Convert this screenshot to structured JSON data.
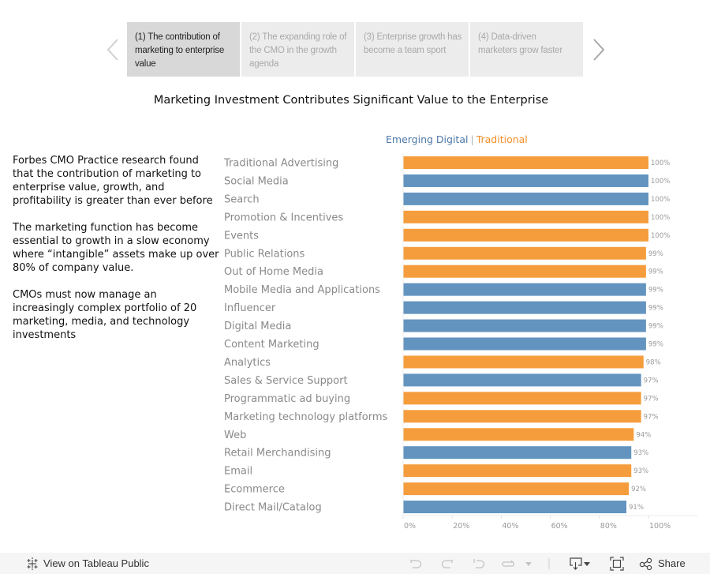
{
  "story": {
    "points": [
      {
        "label": "(1) The contribution of marketing to enterprise value",
        "active": true
      },
      {
        "label": "(2) The expanding role of the CMO in the growth agenda",
        "active": false
      },
      {
        "label": "(3) Enterprise growth has become a team sport",
        "active": false
      },
      {
        "label": "(4) Data-driven marketers grow faster",
        "active": false
      }
    ]
  },
  "title": "Marketing Investment Contributes Significant Value to the Enterprise",
  "legend": {
    "emerging": "Emerging Digital",
    "separator": "|",
    "traditional": "Traditional"
  },
  "narrative": [
    "Forbes CMO Practice research found that the contribution of marketing to enterprise value, growth, and profitability is greater than ever before",
    "The marketing function has become essential to growth in a slow economy where “intangible” assets make up over 80% of company value.",
    "CMOs must now manage an increasingly complex portfolio of 20 marketing, media, and technology investments"
  ],
  "colors": {
    "emerging_digital": "#6394bf",
    "traditional": "#f59d3d"
  },
  "chart_data": {
    "type": "bar",
    "orientation": "horizontal",
    "title": "Marketing Investment Contributes Significant Value to the Enterprise",
    "xlabel": "",
    "ylabel": "",
    "xlim": [
      0,
      100
    ],
    "x_ticks": [
      "0%",
      "20%",
      "40%",
      "60%",
      "80%",
      "100%"
    ],
    "grid": false,
    "legend_position": "top",
    "series_names": [
      "Emerging Digital",
      "Traditional"
    ],
    "categories": [
      "Traditional Advertising",
      "Social Media",
      "Search",
      "Promotion & Incentives",
      "Events",
      "Public Relations",
      "Out of Home Media",
      "Mobile Media and Applications",
      "Influencer",
      "Digital Media",
      "Content Marketing",
      "Analytics",
      "Sales & Service Support",
      "Programmatic ad buying",
      "Marketing technology platforms",
      "Web",
      "Retail Merchandising",
      "Email",
      "Ecommerce",
      "Direct Mail/Catalog"
    ],
    "values": [
      100,
      100,
      100,
      100,
      100,
      99,
      99,
      99,
      99,
      99,
      99,
      98,
      97,
      97,
      97,
      94,
      93,
      93,
      92,
      91
    ],
    "value_labels": [
      "100%",
      "100%",
      "100%",
      "100%",
      "100%",
      "99%",
      "99%",
      "99%",
      "99%",
      "99%",
      "99%",
      "98%",
      "97%",
      "97%",
      "97%",
      "94%",
      "93%",
      "93%",
      "92%",
      "91%"
    ],
    "groups": [
      "Traditional",
      "Emerging Digital",
      "Emerging Digital",
      "Traditional",
      "Traditional",
      "Traditional",
      "Traditional",
      "Emerging Digital",
      "Emerging Digital",
      "Emerging Digital",
      "Emerging Digital",
      "Traditional",
      "Emerging Digital",
      "Traditional",
      "Traditional",
      "Traditional",
      "Emerging Digital",
      "Traditional",
      "Traditional",
      "Emerging Digital"
    ]
  },
  "toolbar": {
    "view_on": "View on Tableau Public",
    "share": "Share"
  }
}
